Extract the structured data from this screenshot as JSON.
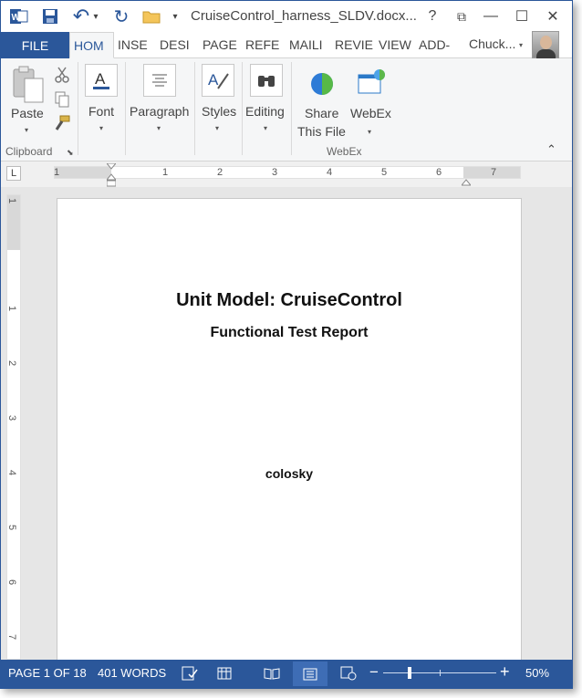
{
  "titlebar": {
    "title": "CruiseControl_harness_SLDV.docx...",
    "icons": [
      "word-logo-icon",
      "save-icon",
      "undo-icon",
      "undo-dropdown-icon",
      "redo-icon",
      "open-folder-icon",
      "customize-qat-icon"
    ],
    "help": "?",
    "ribbon_display": "⧉",
    "minimize": "—",
    "maximize": "☐",
    "close": "✕",
    "undo_glyph": "↶",
    "redo_glyph": "↻",
    "caret": "▾"
  },
  "tabs": {
    "file": "FILE",
    "items": [
      "HOM",
      "INSE",
      "DESI",
      "PAGE",
      "REFE",
      "MAILI",
      "REVIE",
      "VIEW",
      "ADD-"
    ],
    "active": "HOM",
    "user": "Chuck...",
    "user_caret": "▾"
  },
  "ribbon": {
    "clipboard": {
      "paste": "Paste",
      "group": "Clipboard",
      "launcher": "⬊"
    },
    "font": {
      "label": "Font"
    },
    "paragraph": {
      "label": "Paragraph"
    },
    "styles": {
      "label": "Styles"
    },
    "editing": {
      "label": "Editing"
    },
    "webex": {
      "share_line1": "Share",
      "share_line2": "This File",
      "webex": "WebEx",
      "group": "WebEx"
    },
    "collapse": "⌃",
    "caret": "▾"
  },
  "ruler": {
    "tab_selector": "L",
    "h_numbers": [
      "1",
      "1",
      "2",
      "3",
      "4",
      "5",
      "6",
      "7"
    ],
    "v_numbers": [
      "1",
      "1",
      "2",
      "3",
      "4",
      "5",
      "6",
      "7"
    ]
  },
  "document": {
    "title": "Unit Model: CruiseControl",
    "subtitle": "Functional Test Report",
    "author": "colosky"
  },
  "status": {
    "page": "PAGE 1 OF 18",
    "words": "401 WORDS",
    "zoom_minus": "−",
    "zoom_plus": "+",
    "zoom": "50%",
    "zoom_level_percent": 50
  },
  "colors": {
    "accent": "#2b579a",
    "ribbon": "#f5f6f7"
  }
}
